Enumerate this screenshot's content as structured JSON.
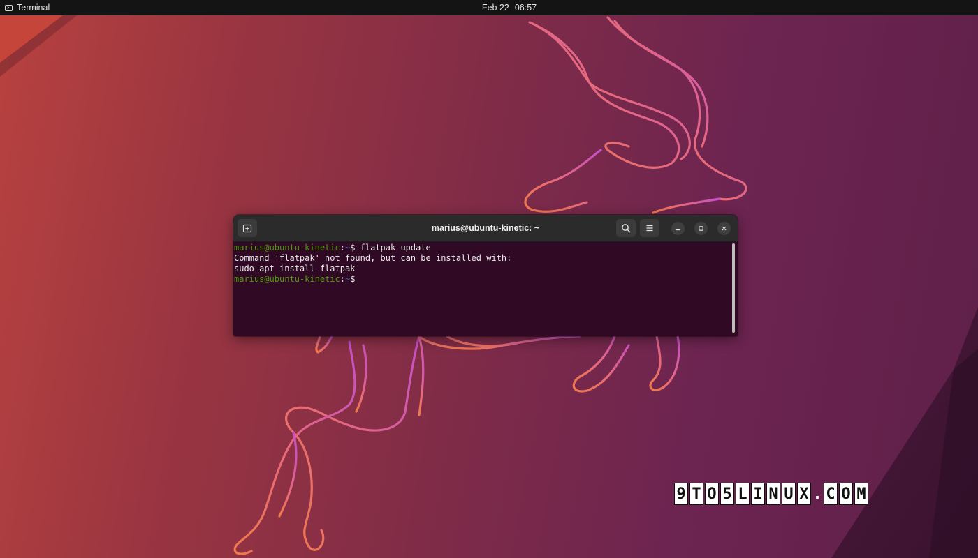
{
  "topbar": {
    "app_name": "Terminal",
    "app_icon": "terminal-icon",
    "date": "Feb 22",
    "time": "06:57"
  },
  "window": {
    "title": "marius@ubuntu-kinetic: ~",
    "icons": {
      "new_tab": "new-tab-icon",
      "search": "search-icon",
      "menu": "hamburger-menu-icon",
      "minimize": "minimize-icon",
      "maximize": "maximize-icon",
      "close": "close-icon"
    }
  },
  "terminal": {
    "prompt_user_host": "marius@ubuntu-kinetic",
    "prompt_sep": ":",
    "prompt_path": "~",
    "prompt_symbol": "$ ",
    "command": "flatpak update",
    "output_line1": "Command 'flatpak' not found, but can be installed with:",
    "output_line2": "sudo apt install flatpak"
  },
  "watermark": {
    "text": "9TO5LINUX.COM"
  },
  "colors": {
    "prompt_green": "#4e9a06",
    "prompt_blue": "#3465a4",
    "terminal_bg": "#300a24",
    "headerbar_bg": "#2b2b2b",
    "topbar_bg": "#141414"
  }
}
